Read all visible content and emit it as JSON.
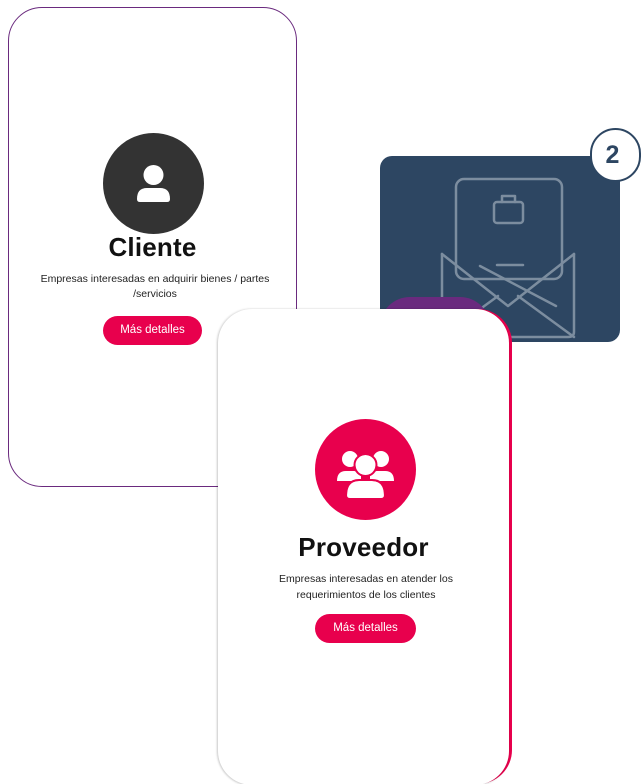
{
  "cards": {
    "cliente": {
      "title": "Cliente",
      "description": "Empresas interesadas en adquirir bienes / partes  /servicios",
      "button_label": "Más detalles",
      "icon": "user-icon"
    },
    "proveedor": {
      "title": "Proveedor",
      "description": "Empresas interesadas en atender los requerimientos de los clientes",
      "button_label": "Más detalles",
      "icon": "users-group-icon"
    }
  },
  "envelope_tile": {
    "icon": "open-envelope-briefcase-icon",
    "step_number": "2"
  },
  "colors": {
    "accent": "#e8004d",
    "card_border": "#6a2a7e",
    "tile_bg": "#2d4662",
    "avatar_dark": "#333333"
  }
}
